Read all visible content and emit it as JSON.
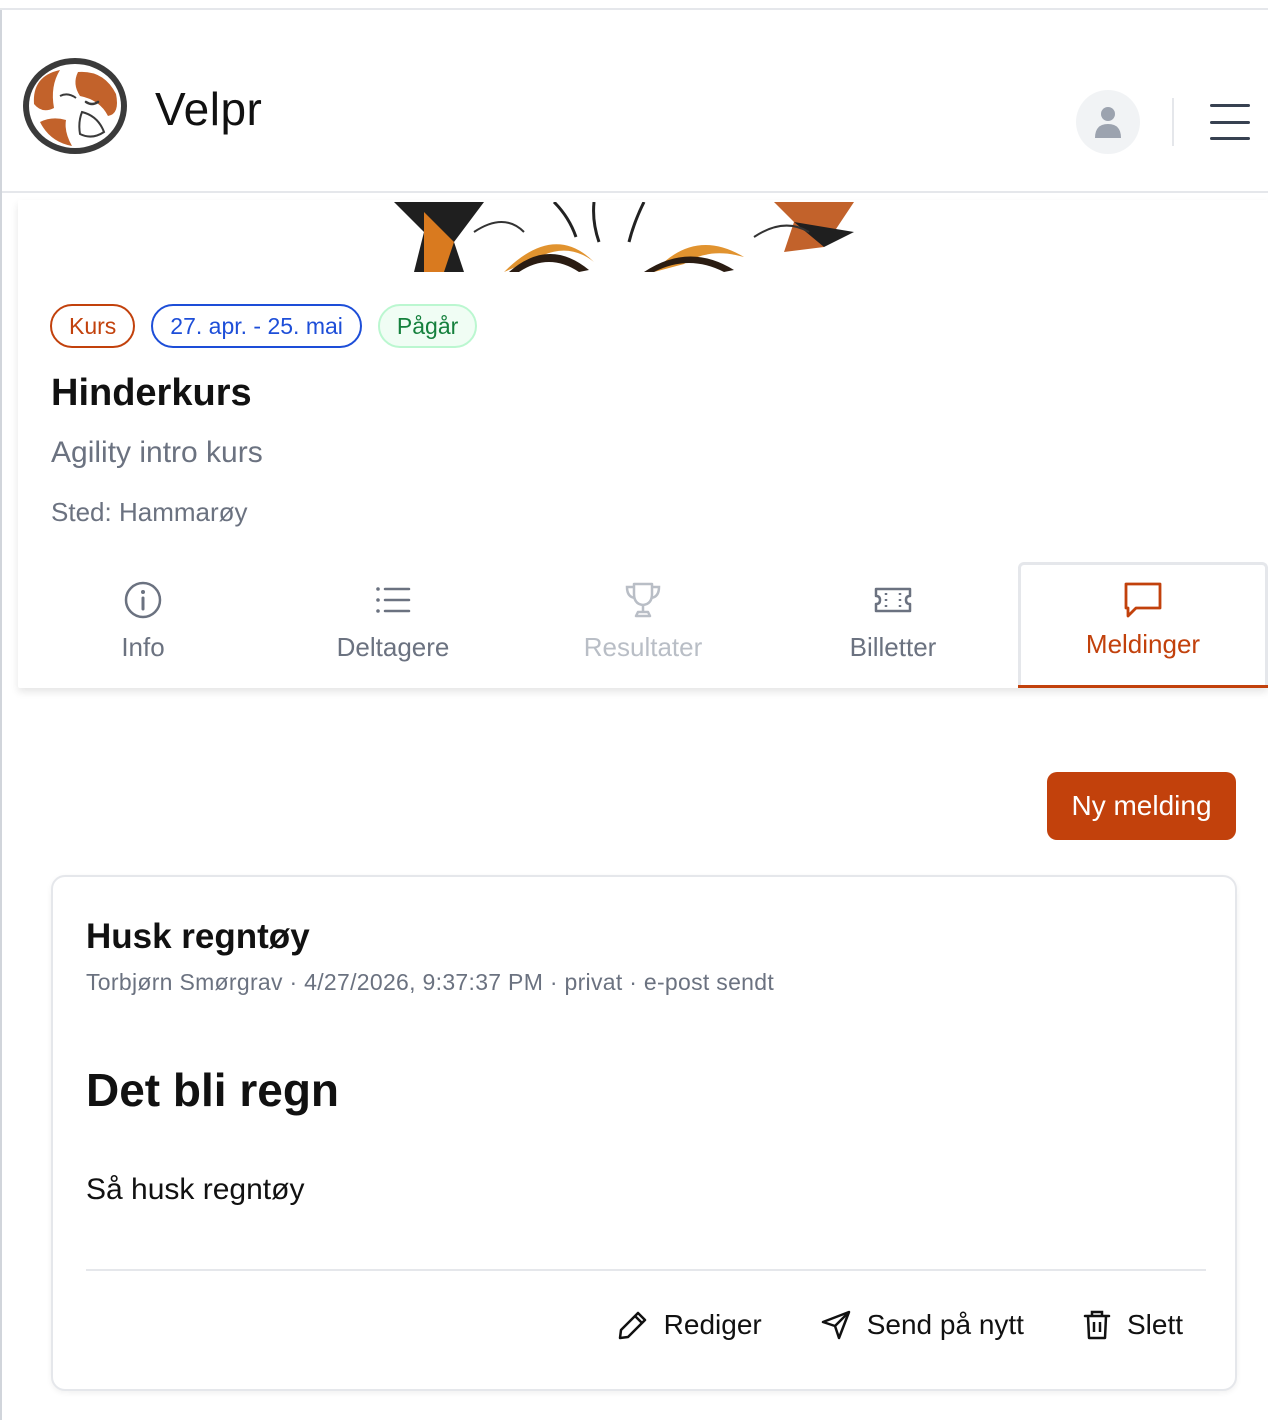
{
  "app": {
    "brand": "Velpr"
  },
  "header": {
    "avatar_icon": "user-avatar-icon",
    "menu_icon": "hamburger-menu-icon"
  },
  "event": {
    "badges": {
      "type": "Kurs",
      "dates": "27. apr. - 25. mai",
      "status": "Pågår"
    },
    "title": "Hinderkurs",
    "subtitle": "Agility intro kurs",
    "location_label": "Sted:",
    "location": "Hammarøy"
  },
  "tabs": [
    {
      "label": "Info",
      "icon": "info-icon",
      "state": "normal"
    },
    {
      "label": "Deltagere",
      "icon": "list-icon",
      "state": "normal"
    },
    {
      "label": "Resultater",
      "icon": "trophy-icon",
      "state": "disabled"
    },
    {
      "label": "Billetter",
      "icon": "ticket-icon",
      "state": "normal"
    },
    {
      "label": "Meldinger",
      "icon": "message-icon",
      "state": "active"
    }
  ],
  "new_message_label": "Ny melding",
  "message": {
    "subject": "Husk regntøy",
    "meta": "Torbjørn Smørgrav · 4/27/2026, 9:37:37 PM · privat · e-post sendt",
    "heading": "Det bli regn",
    "body": "Så husk regntøy",
    "actions": {
      "edit": "Rediger",
      "resend": "Send på nytt",
      "delete": "Slett"
    }
  },
  "colors": {
    "accent": "#c2410c",
    "date_badge": "#1d4ed8",
    "status_badge": "#15803d",
    "muted_text": "#6b7280"
  }
}
